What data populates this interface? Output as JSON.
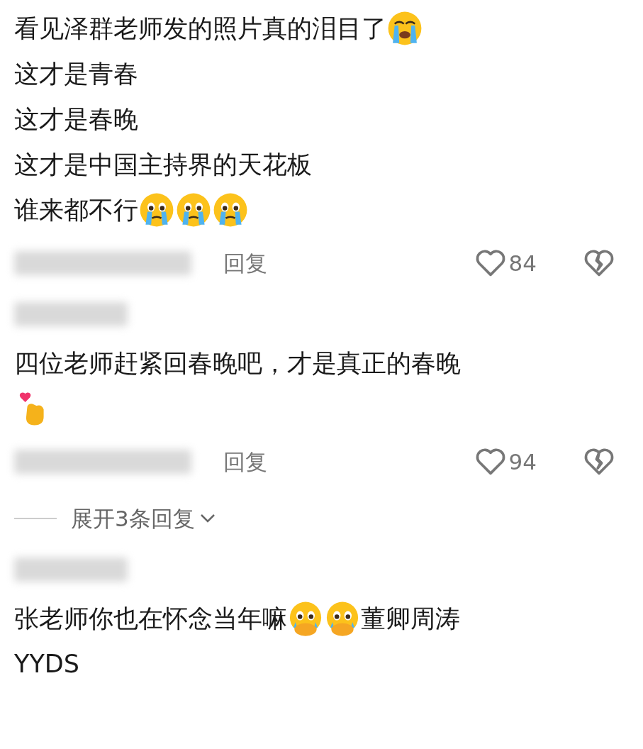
{
  "comments": [
    {
      "lines": [
        [
          {
            "kind": "text",
            "text": "看见泽群老师发的照片真的泪目了"
          },
          {
            "kind": "crying-emoji"
          }
        ],
        [
          {
            "kind": "text",
            "text": "这才是青春"
          }
        ],
        [
          {
            "kind": "text",
            "text": "这才是春晚"
          }
        ],
        [
          {
            "kind": "text",
            "text": "这才是中国主持界的天花板"
          }
        ],
        [
          {
            "kind": "text",
            "text": "谁来都不行"
          },
          {
            "kind": "teary-emoji"
          },
          {
            "kind": "teary-emoji"
          },
          {
            "kind": "teary-emoji"
          }
        ]
      ],
      "reply": "回复",
      "likes": "84"
    },
    {
      "author_blurred": true,
      "lines": [
        [
          {
            "kind": "text",
            "text": "四位老师赶紧回春晚吧，才是真正的春晚"
          }
        ],
        [
          {
            "kind": "finger-heart-emoji"
          }
        ]
      ],
      "reply": "回复",
      "likes": "94",
      "expand": "展开3条回复"
    },
    {
      "author_blurred": true,
      "lines": [
        [
          {
            "kind": "text",
            "text": "张老师你也在怀念当年嘛"
          },
          {
            "kind": "pleading-emoji"
          },
          {
            "kind": "pleading-emoji"
          },
          {
            "kind": "text",
            "text": "董卿周涛"
          }
        ],
        [
          {
            "kind": "text",
            "text": "YYDS"
          }
        ]
      ]
    }
  ]
}
